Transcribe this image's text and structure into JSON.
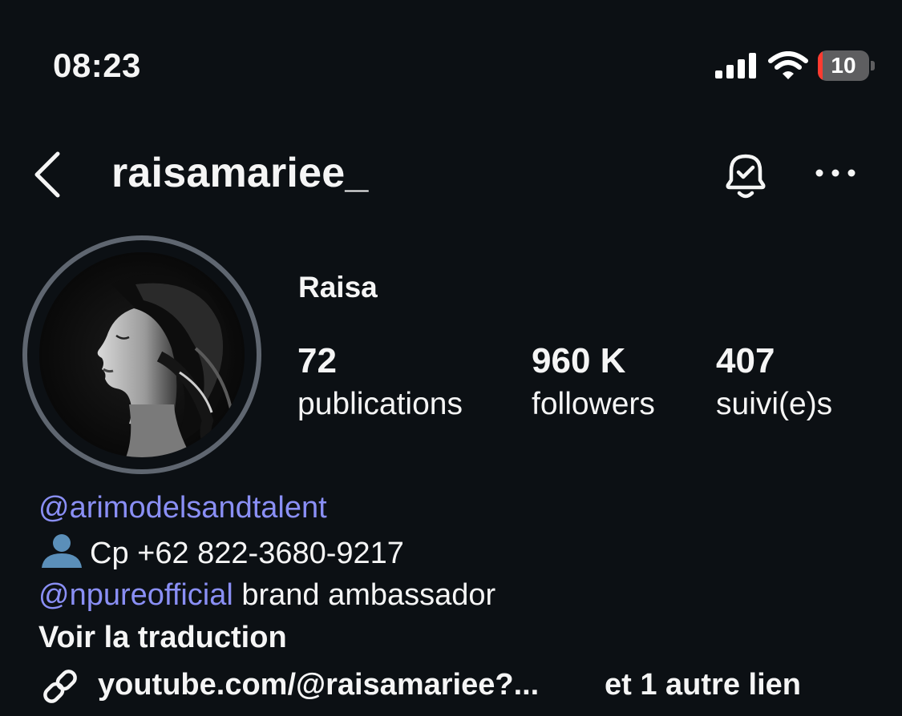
{
  "status_bar": {
    "time": "08:23",
    "battery_level": "10",
    "battery_color": "#ff3b30",
    "icons": [
      "signal-icon",
      "wifi-icon",
      "battery-icon"
    ]
  },
  "header": {
    "username": "raisamariee_",
    "icons": [
      "back-chevron-icon",
      "bell-check-icon",
      "more-dots-icon"
    ]
  },
  "profile": {
    "display_name": "Raisa",
    "stats": {
      "posts": {
        "count": "72",
        "label": "publications"
      },
      "followers": {
        "count": "960 K",
        "label": "followers"
      },
      "following": {
        "count": "407",
        "label": "suivi(e)s"
      }
    },
    "bio": {
      "line1_mention": "@arimodelsandtalent",
      "line2_text": "Cp +62 822-3680-9217",
      "line3_mention": "@npureofficial",
      "line3_text": " brand ambassador",
      "translate": "Voir la traduction",
      "link_text": "youtube.com/@raisamariee?...",
      "link_more": "et 1 autre lien"
    }
  },
  "colors": {
    "background": "#0c1014",
    "mention": "#8a8ff5",
    "text": "#f5f5f5"
  }
}
